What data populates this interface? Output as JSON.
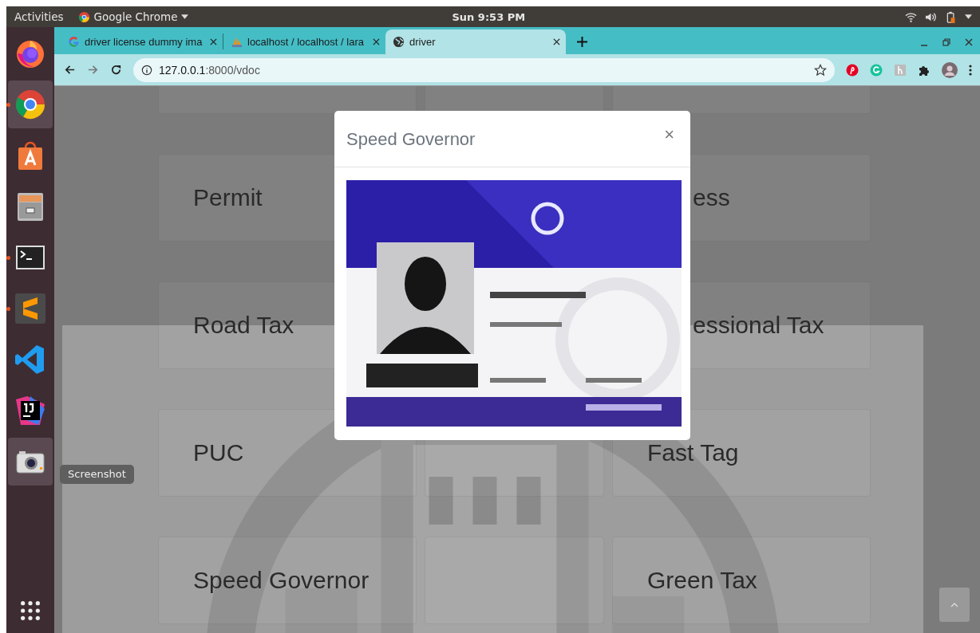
{
  "top_bar": {
    "activities": "Activities",
    "app_menu": "Google Chrome",
    "clock": "Sun  9:53 PM"
  },
  "dock": {
    "items": [
      {
        "kind": "firefox",
        "running": false,
        "selected": false
      },
      {
        "kind": "chrome",
        "running": true,
        "selected": true
      },
      {
        "kind": "software",
        "running": false,
        "selected": false
      },
      {
        "kind": "files",
        "running": false,
        "selected": false
      },
      {
        "kind": "terminal",
        "running": true,
        "selected": false
      },
      {
        "kind": "sublime",
        "running": true,
        "selected": false
      },
      {
        "kind": "vscode",
        "running": false,
        "selected": false
      },
      {
        "kind": "intellij",
        "running": false,
        "selected": false
      },
      {
        "kind": "camera",
        "running": false,
        "selected": true
      }
    ],
    "tooltip": "Screenshot"
  },
  "tabs": [
    {
      "title": "driver license dummy ima",
      "kind": "google",
      "selected": false
    },
    {
      "title": "localhost / localhost / lara",
      "kind": "pma",
      "selected": false
    },
    {
      "title": "driver",
      "kind": "globe",
      "selected": true
    }
  ],
  "address_bar": {
    "host": "127.0.0.1",
    "path": ":8000/vdoc"
  },
  "card_rows": [
    {
      "left": {},
      "middle": {},
      "right": {}
    },
    {
      "left": {
        "label": "Permit"
      },
      "right": {
        "label": "ess",
        "covered": true
      }
    },
    {
      "left": {
        "label": "Road Tax"
      },
      "right": {
        "label": "essional Tax",
        "covered": true
      }
    },
    {
      "left": {
        "label": "PUC"
      },
      "middle": {},
      "right": {
        "label": "Fast Tag"
      }
    },
    {
      "left": {
        "label": "Speed Governor"
      },
      "middle": {},
      "right": {
        "label": "Green Tax"
      }
    }
  ],
  "modal": {
    "title": "Speed Governor",
    "close": "×"
  }
}
